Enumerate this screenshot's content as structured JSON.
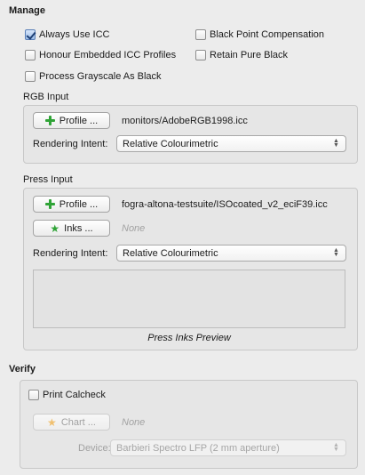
{
  "manage": {
    "title": "Manage",
    "options": {
      "always_use_icc": {
        "label": "Always Use ICC",
        "checked": true
      },
      "black_point_compensation": {
        "label": "Black Point Compensation",
        "checked": false
      },
      "honour_embedded": {
        "label": "Honour Embedded ICC Profiles",
        "checked": false
      },
      "retain_pure_black": {
        "label": "Retain Pure Black",
        "checked": false
      },
      "process_grayscale": {
        "label": "Process Grayscale As Black",
        "checked": false
      }
    }
  },
  "rgb_input": {
    "title": "RGB Input",
    "profile_button": "Profile ...",
    "profile_path": "monitors/AdobeRGB1998.icc",
    "rendering_intent_label": "Rendering Intent:",
    "rendering_intent_value": "Relative Colourimetric"
  },
  "press_input": {
    "title": "Press Input",
    "profile_button": "Profile ...",
    "profile_path": "fogra-altona-testsuite/ISOcoated_v2_eciF39.icc",
    "inks_button": "Inks ...",
    "inks_value": "None",
    "rendering_intent_label": "Rendering Intent:",
    "rendering_intent_value": "Relative Colourimetric",
    "preview_caption": "Press Inks Preview"
  },
  "verify": {
    "title": "Verify",
    "print_calcheck": {
      "label": "Print Calcheck",
      "checked": false
    },
    "chart_button": "Chart ...",
    "chart_value": "None",
    "device_label": "Device:",
    "device_value": "Barbieri Spectro LFP (2 mm aperture)"
  },
  "colors": {
    "window_bg": "#ececec",
    "group_bg": "#e6e6e6",
    "accent_green": "#2fa336"
  },
  "icons": {
    "add": "plus-icon",
    "star": "star-icon",
    "popup": "updown-arrows-icon"
  }
}
